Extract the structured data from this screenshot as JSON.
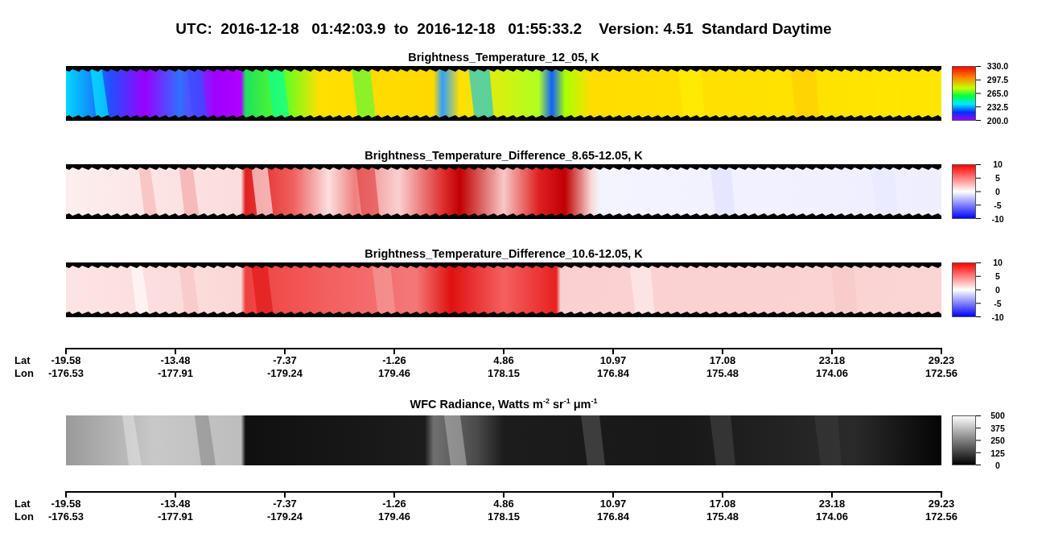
{
  "header": {
    "title": "UTC:  2016-12-18   01:42:03.9  to  2016-12-18   01:55:33.2    Version: 4.51  Standard Daytime"
  },
  "sections": [
    {
      "kind": "panel",
      "title": "Brightness_Temperature_12_05, K",
      "colorbar": {
        "kind": "rainbow",
        "ticks": [
          "330.0",
          "297.5",
          "265.0",
          "232.5",
          "200.0"
        ]
      }
    },
    {
      "kind": "panel",
      "title": "Brightness_Temperature_Difference_8.65-12.05, K",
      "colorbar": {
        "kind": "diverging",
        "ticks": [
          "10",
          "5",
          "0",
          "-5",
          "-10"
        ]
      }
    },
    {
      "kind": "panel",
      "title": "Brightness_Temperature_Difference_10.6-12.05, K",
      "colorbar": {
        "kind": "diverging",
        "ticks": [
          "10",
          "5",
          "0",
          "-5",
          "-10"
        ]
      }
    },
    {
      "kind": "axis",
      "lat_label": "Lat",
      "lon_label": "Lon",
      "ticks": [
        {
          "lat": "-19.58",
          "lon": "-176.53"
        },
        {
          "lat": "-13.48",
          "lon": "-177.91"
        },
        {
          "lat": "-7.37",
          "lon": "-179.24"
        },
        {
          "lat": "-1.26",
          "lon": "179.46"
        },
        {
          "lat": "4.86",
          "lon": "178.15"
        },
        {
          "lat": "10.97",
          "lon": "176.84"
        },
        {
          "lat": "17.08",
          "lon": "175.48"
        },
        {
          "lat": "23.18",
          "lon": "174.06"
        },
        {
          "lat": "29.23",
          "lon": "172.56"
        }
      ]
    },
    {
      "kind": "panel",
      "title": "WFC Radiance, Watts m$^{-2}$ sr$^{-1}$ μm$^{-1}$",
      "colorbar": {
        "kind": "gray",
        "ticks": [
          "500",
          "375",
          "250",
          "125",
          "0"
        ]
      }
    },
    {
      "kind": "axis",
      "lat_label": "Lat",
      "lon_label": "Lon",
      "ticks": [
        {
          "lat": "-19.58",
          "lon": "-176.53"
        },
        {
          "lat": "-13.48",
          "lon": "-177.91"
        },
        {
          "lat": "-7.37",
          "lon": "-179.24"
        },
        {
          "lat": "-1.26",
          "lon": "179.46"
        },
        {
          "lat": "4.86",
          "lon": "178.15"
        },
        {
          "lat": "10.97",
          "lon": "176.84"
        },
        {
          "lat": "17.08",
          "lon": "175.48"
        },
        {
          "lat": "23.18",
          "lon": "174.06"
        },
        {
          "lat": "29.23",
          "lon": "172.56"
        }
      ]
    }
  ]
}
